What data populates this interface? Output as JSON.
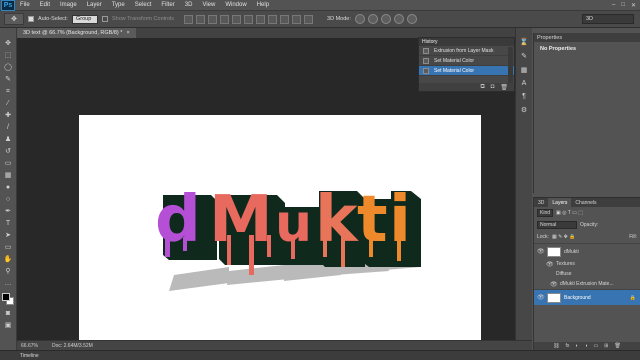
{
  "app": {
    "logo": "Ps"
  },
  "menu": [
    "File",
    "Edit",
    "Image",
    "Layer",
    "Type",
    "Select",
    "Filter",
    "3D",
    "View",
    "Window",
    "Help"
  ],
  "window_controls": [
    "–",
    "□",
    "✕"
  ],
  "options": {
    "auto_select_label": "Auto-Select:",
    "auto_select_value": "Group",
    "transform_label": "Show Transform Controls",
    "mode3d_label": "3D Mode:",
    "workspace": "3D"
  },
  "document": {
    "tab_title": "3D text @ 66.7% (Background, RGB/8) *",
    "tab_close": "×",
    "canvas_text": "dMukti",
    "colors": {
      "d": "#b44fd6",
      "M": "#e8695d",
      "u": "#e8695d",
      "k": "#e8745a",
      "t": "#ef8a2c",
      "i": "#ef8a2c",
      "extrusion": "#0f2a1c"
    }
  },
  "status": {
    "zoom": "66.67%",
    "doc": "Doc: 2.64M/3.52M"
  },
  "timeline_label": "Timeline",
  "history": {
    "title": "History",
    "items": [
      {
        "label": "Extrusion from Layer Mask",
        "selected": false
      },
      {
        "label": "Set Material Color",
        "selected": false
      },
      {
        "label": "Set Material Color",
        "selected": true
      }
    ]
  },
  "properties": {
    "tab": "Properties",
    "title": "No Properties"
  },
  "layers": {
    "tabs": [
      "3D",
      "Layers",
      "Channels"
    ],
    "active_tab": "Layers",
    "kind_label": "Kind",
    "blend_mode": "Normal",
    "opacity_label": "Opacity:",
    "lock_label": "Lock:",
    "fill_label": "Fill:",
    "items": [
      {
        "name": "dMukti",
        "selected": false
      },
      {
        "name": "Background",
        "selected": true
      }
    ],
    "sub": {
      "textures": "Textures",
      "diffuse": "Diffuse",
      "material": "dMukti Extrusion Mate..."
    }
  }
}
